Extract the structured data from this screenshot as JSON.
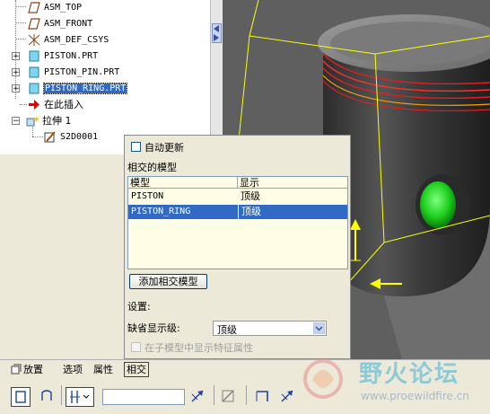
{
  "model_tree": {
    "items": [
      {
        "label": "ASM_TOP",
        "icon": "datum-plane-icon",
        "expandable": false,
        "selected": false
      },
      {
        "label": "ASM_FRONT",
        "icon": "datum-plane-icon",
        "expandable": false,
        "selected": false
      },
      {
        "label": "ASM_DEF_CSYS",
        "icon": "coordinate-system-icon",
        "expandable": false,
        "selected": false
      },
      {
        "label": "PISTON.PRT",
        "icon": "part-icon",
        "expandable": true,
        "selected": false
      },
      {
        "label": "PISTON_PIN.PRT",
        "icon": "part-icon",
        "expandable": true,
        "selected": false
      },
      {
        "label": "PISTON_RING.PRT",
        "icon": "part-icon",
        "expandable": true,
        "selected": true
      },
      {
        "label": "在此插入",
        "icon": "insert-here-arrow-icon",
        "expandable": false,
        "selected": false
      },
      {
        "label": "拉伸 1",
        "icon": "extrude-feature-icon",
        "expandable": true,
        "selected": false
      },
      {
        "label": "S2D0001",
        "icon": "sketch-icon",
        "expandable": false,
        "selected": false
      }
    ]
  },
  "intersect_panel": {
    "auto_update_label": "自动更新",
    "auto_update_checked": false,
    "section_title": "相交的模型",
    "columns": [
      "模型",
      "显示"
    ],
    "rows": [
      {
        "model": "PISTON",
        "display": "顶级",
        "selected": false
      },
      {
        "model": "PISTON_RING",
        "display": "顶级",
        "selected": true
      }
    ],
    "add_button_label": "添加相交模型",
    "settings_label": "设置:",
    "default_level_label": "缺省显示级:",
    "default_level_value": "顶级",
    "show_feature_attr_label": "在子模型中显示特征属性",
    "show_feature_attr_checked": false
  },
  "tabs": [
    {
      "label": "放置",
      "active": false
    },
    {
      "label": "选项",
      "active": false
    },
    {
      "label": "属性",
      "active": false
    },
    {
      "label": "相交",
      "active": true
    }
  ],
  "toolbar": {
    "solid_icon": "solid-extrude-icon",
    "surface_icon": "surface-extrude-icon",
    "depth_icon": "depth-blind-icon",
    "depth_value": "",
    "flip_icon": "flip-direction-icon",
    "remove_material_icon": "remove-material-icon",
    "thicken_icon": "thicken-icon",
    "flip2_icon": "flip-thicken-icon"
  },
  "watermark": {
    "title": "野火论坛",
    "url": "www.proewildfire.cn"
  },
  "colors": {
    "selection": "#316ac5",
    "viewport_bg": "#5f5f5f",
    "highlight_green": "#1fd11f",
    "yellow_preview": "#ffff00"
  }
}
